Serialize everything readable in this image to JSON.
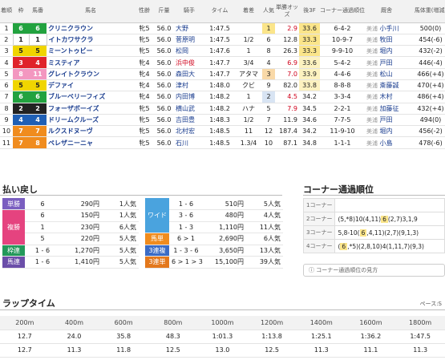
{
  "results": {
    "headers": [
      "着順",
      "枠",
      "馬番",
      "馬名",
      "性齢",
      "斤量",
      "騎手",
      "タイム",
      "着差",
      "人気",
      "単勝オッズ",
      "後3F",
      "コーナー通過順位",
      "厩舎",
      "馬体重(増減)"
    ],
    "rows": [
      {
        "rank": "1",
        "waku": "6",
        "umaban": "6",
        "name": "クリニクラウン",
        "sexage": "牝5",
        "kinryo": "56.0",
        "jockey": "大野",
        "time": "1:47.5",
        "margin": "",
        "pop": "1",
        "odds": "2.9",
        "last3f": "33.6",
        "corner": "6-4-2",
        "loc": "美浦",
        "trainer": "小手川",
        "weight": "500(0)"
      },
      {
        "rank": "2",
        "waku": "1",
        "umaban": "1",
        "name": "イトカワサクラ",
        "sexage": "牝5",
        "kinryo": "56.0",
        "jockey": "菅原明",
        "time": "1:47.5",
        "margin": "1/2",
        "pop": "6",
        "odds": "12.8",
        "last3f": "33.3",
        "corner": "10-9-7",
        "loc": "美浦",
        "trainer": "牧田",
        "weight": "454(-6)"
      },
      {
        "rank": "3",
        "waku": "5",
        "umaban": "5",
        "name": "ミーントゥビー",
        "sexage": "牝5",
        "kinryo": "56.0",
        "jockey": "松岡",
        "time": "1:47.6",
        "margin": "1",
        "pop": "8",
        "odds": "26.3",
        "last3f": "33.3",
        "corner": "9-9-10",
        "loc": "美浦",
        "trainer": "堀内",
        "weight": "432(-2)"
      },
      {
        "rank": "4",
        "waku": "3",
        "umaban": "4",
        "name": "ミスティア",
        "sexage": "牝4",
        "kinryo": "56.0",
        "jockey": "浜中俊",
        "time": "1:47.7",
        "margin": "3/4",
        "pop": "4",
        "odds": "6.9",
        "last3f": "33.6",
        "corner": "5-4-2",
        "loc": "美浦",
        "trainer": "戸田",
        "weight": "446(-4)"
      },
      {
        "rank": "5",
        "waku": "8",
        "umaban": "11",
        "name": "グレイトクラウン",
        "sexage": "牝4",
        "kinryo": "56.0",
        "jockey": "森田大",
        "time": "1:47.7",
        "margin": "アタマ",
        "pop": "3",
        "odds": "7.0",
        "last3f": "33.9",
        "corner": "4-4-6",
        "loc": "美浦",
        "trainer": "松山",
        "weight": "466(+4)"
      },
      {
        "rank": "6",
        "waku": "5",
        "umaban": "5",
        "name": "デファイ",
        "sexage": "牝4",
        "kinryo": "56.0",
        "jockey": "津村",
        "time": "1:48.0",
        "margin": "クビ",
        "pop": "9",
        "odds": "82.0",
        "last3f": "33.8",
        "corner": "8-8-8",
        "loc": "美浦",
        "trainer": "斎藤誠",
        "weight": "470(+4)"
      },
      {
        "rank": "7",
        "waku": "6",
        "umaban": "6",
        "name": "ブルーベリーフィズ",
        "sexage": "牝4",
        "kinryo": "56.0",
        "jockey": "内田博",
        "time": "1:48.2",
        "margin": "1",
        "pop": "2",
        "odds": "4.5",
        "last3f": "34.2",
        "corner": "3-3-4",
        "loc": "美浦",
        "trainer": "木村",
        "weight": "486(+4)"
      },
      {
        "rank": "8",
        "waku": "2",
        "umaban": "2",
        "name": "フォーザボーイズ",
        "sexage": "牝5",
        "kinryo": "56.0",
        "jockey": "横山武",
        "time": "1:48.2",
        "margin": "ハナ",
        "pop": "5",
        "odds": "7.9",
        "last3f": "34.5",
        "corner": "2-2-1",
        "loc": "美浦",
        "trainer": "加藤征",
        "weight": "432(+4)"
      },
      {
        "rank": "9",
        "waku": "4",
        "umaban": "4",
        "name": "ドリームクルーズ",
        "sexage": "牝5",
        "kinryo": "56.0",
        "jockey": "吉田豊",
        "time": "1:48.3",
        "margin": "1/2",
        "pop": "7",
        "odds": "11.9",
        "last3f": "34.6",
        "corner": "7-7-5",
        "loc": "美浦",
        "trainer": "戸田",
        "weight": "494(0)"
      },
      {
        "rank": "10",
        "waku": "7",
        "umaban": "7",
        "name": "ルクスドヌーヴ",
        "sexage": "牝5",
        "kinryo": "56.0",
        "jockey": "北村宏",
        "time": "1:48.5",
        "margin": "11",
        "pop": "12",
        "odds": "187.4",
        "last3f": "34.2",
        "corner": "11-9-10",
        "loc": "美浦",
        "trainer": "堀内",
        "weight": "456(-2)"
      },
      {
        "rank": "11",
        "waku": "7",
        "umaban": "8",
        "name": "ペレザニーニャ",
        "sexage": "牝5",
        "kinryo": "56.0",
        "jockey": "石川",
        "time": "1:48.5",
        "margin": "1.3/4",
        "pop": "10",
        "odds": "87.1",
        "last3f": "34.8",
        "corner": "1-1-1",
        "loc": "美浦",
        "trainer": "小島",
        "weight": "478(-6)"
      }
    ]
  },
  "payout": {
    "title": "払い戻し",
    "left": [
      {
        "type": "単勝",
        "num": "6",
        "yen": "290円",
        "pop": "1人気"
      },
      {
        "type": "複勝",
        "num": "6",
        "yen": "150円",
        "pop": "1人気"
      },
      {
        "type": "",
        "num": "1",
        "yen": "230円",
        "pop": "6人気"
      },
      {
        "type": "",
        "num": "5",
        "yen": "220円",
        "pop": "5人気"
      },
      {
        "type": "枠連",
        "num": "1 - 6",
        "yen": "1,270円",
        "pop": "5人気"
      },
      {
        "type": "馬連",
        "num": "1 - 6",
        "yen": "1,410円",
        "pop": "5人気"
      }
    ],
    "right": [
      {
        "type": "ワイド",
        "num": "1 - 6",
        "yen": "510円",
        "pop": "5人気"
      },
      {
        "type": "",
        "num": "3 - 6",
        "yen": "480円",
        "pop": "4人気"
      },
      {
        "type": "",
        "num": "1 - 3",
        "yen": "1,110円",
        "pop": "11人気"
      },
      {
        "type": "馬単",
        "num": "6 > 1",
        "yen": "2,690円",
        "pop": "6人気"
      },
      {
        "type": "3連複",
        "num": "1 - 3 - 6",
        "yen": "3,650円",
        "pop": "13人気"
      },
      {
        "type": "3連単",
        "num": "6 > 1 > 3",
        "yen": "15,100円",
        "pop": "39人気"
      }
    ]
  },
  "corners": {
    "title": "コーナー通過順位",
    "rows": [
      {
        "label": "1コーナー",
        "pre": "",
        "hl": "",
        "post": ""
      },
      {
        "label": "2コーナー",
        "pre": "(5,*8)10(4,11)",
        "hl": "6",
        "post": "(2,7)3,1,9"
      },
      {
        "label": "3コーナー",
        "pre": "5,8-10(",
        "hl": "6",
        "post": ",4,11)(2,7)(9,1,3)"
      },
      {
        "label": "4コーナー",
        "pre": "(",
        "hl": "6",
        "post": ",*5)(2,8,10)4(1,11,7)(9,3)"
      }
    ],
    "howto": "コーナー通過順位の見方"
  },
  "lap": {
    "title": "ラップタイム",
    "pace": "ペース:S",
    "distances": [
      "200m",
      "400m",
      "600m",
      "800m",
      "1000m",
      "1200m",
      "1400m",
      "1600m",
      "1800m"
    ],
    "cumulative": [
      "12.7",
      "24.0",
      "35.8",
      "48.3",
      "1:01.3",
      "1:13.8",
      "1:25.1",
      "1:36.2",
      "1:47.5"
    ],
    "split": [
      "12.7",
      "11.3",
      "11.8",
      "12.5",
      "13.0",
      "12.5",
      "11.3",
      "11.1",
      "11.3"
    ]
  },
  "colors": {
    "waku1": "#ffffff",
    "waku2": "#222222",
    "waku3": "#e0232a",
    "waku4": "#1f5fb5",
    "waku5": "#f0d500",
    "waku6": "#22a23f",
    "waku7": "#f08c1e",
    "waku8": "#f397c0",
    "bet_tansho": "#7a5ec0",
    "bet_fukusho": "#e5437f",
    "bet_wakuren": "#23985a",
    "bet_umaren": "#6b4ea9",
    "bet_wide": "#4aa3de",
    "bet_umatan": "#f08c1e",
    "bet_3renpuku": "#3a6cc6",
    "bet_3rentan": "#e3781c"
  }
}
